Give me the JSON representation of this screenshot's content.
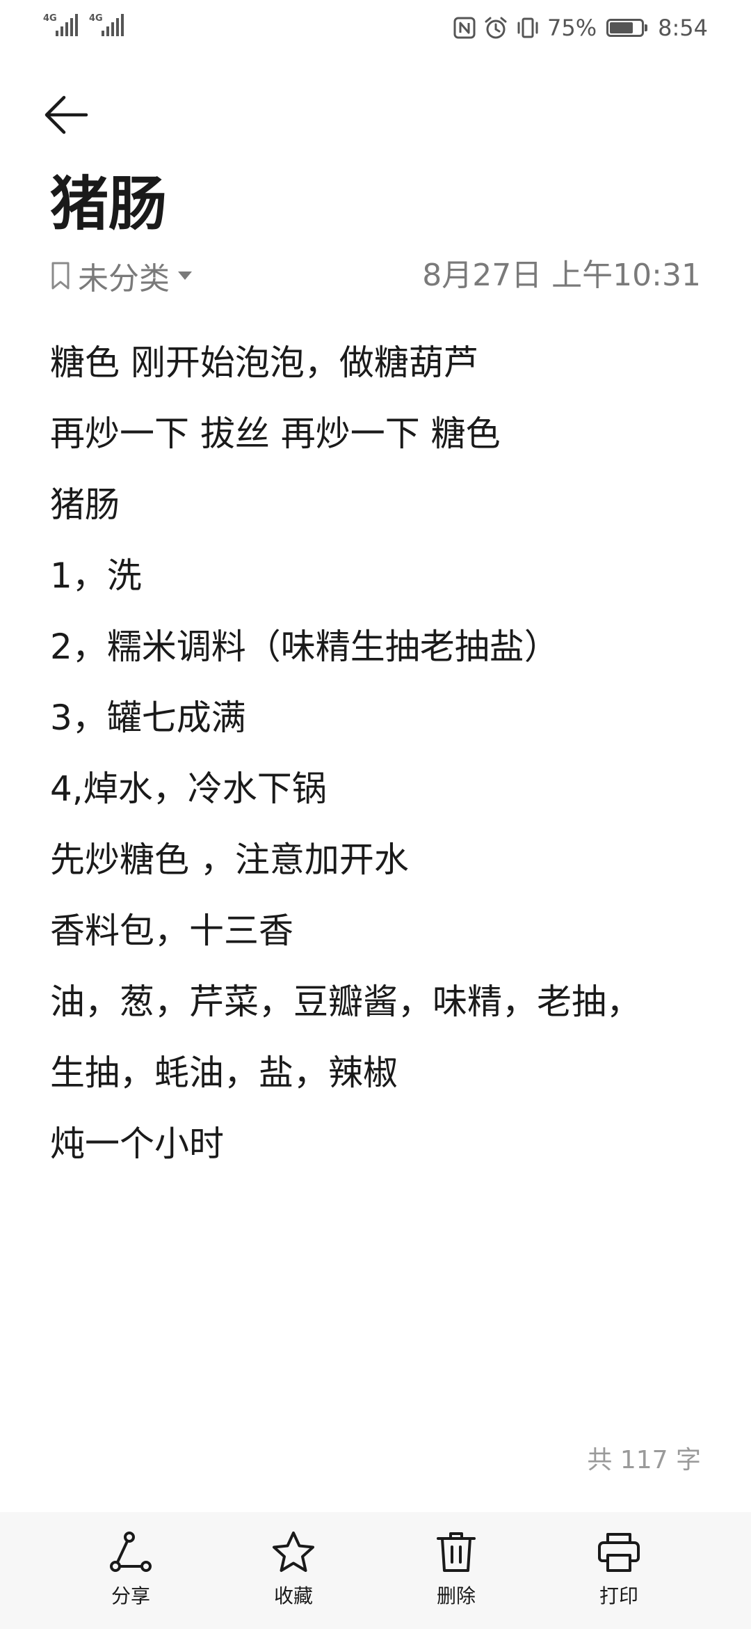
{
  "status_bar": {
    "network_1": "4G",
    "network_2": "4G",
    "battery_percent": "75%",
    "battery_level": 0.75,
    "time": "8:54",
    "icons": [
      "nfc-icon",
      "alarm-icon",
      "vibrate-icon",
      "battery-icon"
    ]
  },
  "header": {
    "back_icon": "back-arrow-icon"
  },
  "note": {
    "title": "猪肠",
    "category": "未分类",
    "timestamp": "8月27日 上午10:31",
    "lines": [
      "糖色 刚开始泡泡，做糖葫芦",
      "再炒一下 拔丝 再炒一下 糖色",
      "猪肠",
      "1，洗",
      "2，糯米调料（味精生抽老抽盐）",
      "3，罐七成满",
      "4,焯水，冷水下锅",
      "先炒糖色 ，注意加开水",
      "香料包，十三香",
      "油，葱，芹菜，豆瓣酱，味精，老抽，",
      "生抽，蚝油，盐，辣椒",
      "炖一个小时"
    ],
    "word_count": "共 117 字"
  },
  "toolbar": {
    "share_label": "分享",
    "favorite_label": "收藏",
    "delete_label": "删除",
    "print_label": "打印"
  }
}
